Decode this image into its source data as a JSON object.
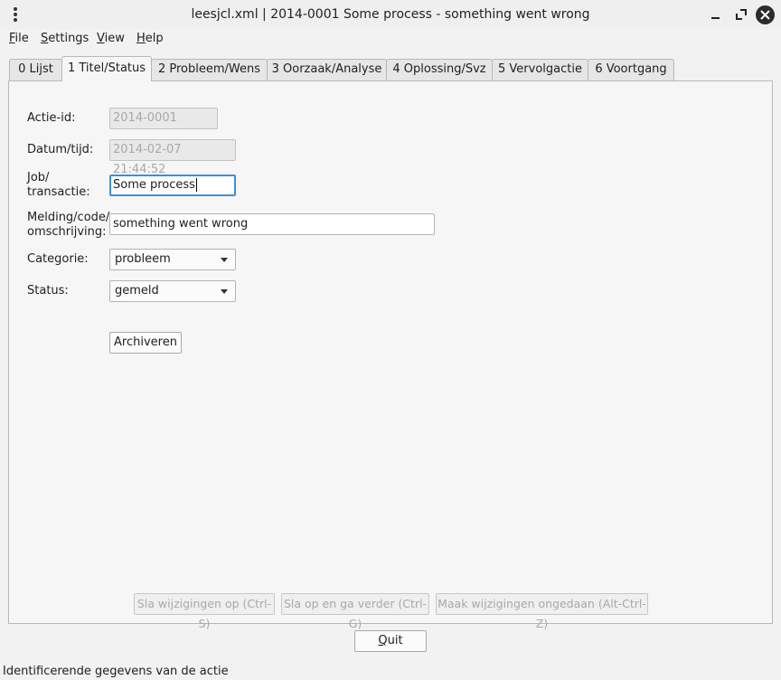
{
  "window": {
    "title": "leesjcl.xml | 2014-0001 Some process - something went wrong"
  },
  "menu": {
    "file": {
      "mnemonic": "F",
      "rest": "ile"
    },
    "settings": {
      "mnemonic": "S",
      "rest": "ettings"
    },
    "view": {
      "mnemonic": "V",
      "rest": "iew"
    },
    "help": {
      "mnemonic": "H",
      "rest": "elp"
    }
  },
  "tabs": [
    {
      "label": "0 Lijst"
    },
    {
      "label": "1 Titel/Status"
    },
    {
      "label": "2 Probleem/Wens"
    },
    {
      "label": "3 Oorzaak/Analyse"
    },
    {
      "label": "4 Oplossing/Svz"
    },
    {
      "label": "5 Vervolgactie"
    },
    {
      "label": "6 Voortgang"
    }
  ],
  "active_tab": "1 Titel/Status",
  "form": {
    "actie_id": {
      "label": "Actie-id:",
      "value": "2014-0001"
    },
    "datum": {
      "label": "Datum/tijd:",
      "value": "2014-02-07 21:44:52"
    },
    "job": {
      "label_line1": "Job/",
      "label_line2": "transactie:",
      "value": "Some process"
    },
    "melding": {
      "label_line1": "Melding/code/",
      "label_line2": "omschrijving:",
      "value": "something went wrong"
    },
    "categorie": {
      "label": "Categorie:",
      "value": "probleem"
    },
    "status": {
      "label": "Status:",
      "value": "gemeld"
    },
    "archiveren": "Archiveren"
  },
  "actions": {
    "save": "Sla wijzigingen op (Ctrl-S)",
    "save_next": "Sla op en ga verder (Ctrl-G)",
    "undo": "Maak wijzigingen ongedaan (Alt-Ctrl-Z)"
  },
  "quit": {
    "mnemonic": "Q",
    "rest": "uit"
  },
  "statusbar": "Identificerende gegevens van de actie",
  "colors": {
    "focus": "#3d8ee0",
    "disabled_text": "#a8a8a8"
  }
}
